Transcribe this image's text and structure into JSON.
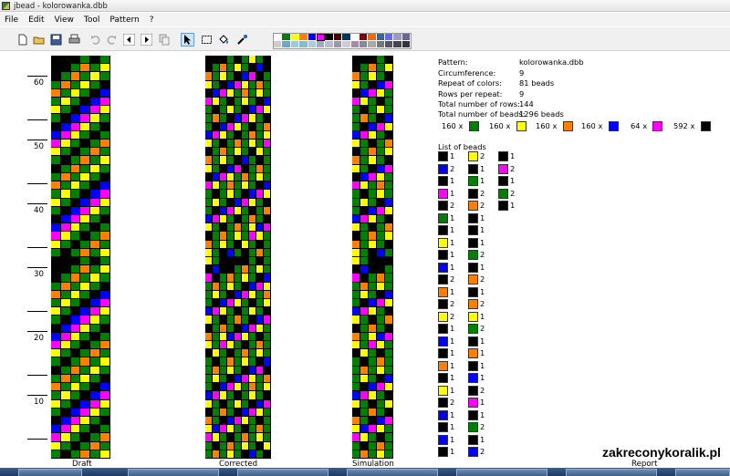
{
  "window": {
    "title": "jbead - kolorowanka.dbb"
  },
  "menu": [
    "File",
    "Edit",
    "View",
    "Tool",
    "Pattern",
    "?"
  ],
  "toolbar": {
    "icons": [
      "new-file-icon",
      "open-folder-icon",
      "save-disk-icon",
      "print-icon",
      "undo-icon",
      "redo-icon",
      "arrow-left-icon",
      "arrow-right-icon",
      "copy-icon",
      "pointer-icon",
      "select-rect-icon",
      "fill-bucket-icon",
      "eyedropper-icon"
    ]
  },
  "palette": [
    "#ffffff",
    "#008000",
    "#ffff00",
    "#ff8000",
    "#0000ff",
    "#ff00ff",
    "#000000",
    "#4d0000",
    "#003366",
    "#ffffff",
    "#800000",
    "#ff6600",
    "#336699",
    "#6666ff",
    "#9999cc",
    "#666699",
    "#cccccc",
    "#66aacc",
    "#99ccdd",
    "#88bbcc",
    "#aaccdd",
    "#99aacc",
    "#bbbbcc",
    "#9999aa",
    "#ccccdd",
    "#aa88aa",
    "#888899",
    "#aaaaaa",
    "#777777",
    "#555566",
    "#444455",
    "#333344"
  ],
  "colors": {
    "0": "#000000",
    "1": "#008000",
    "2": "#ffff00",
    "3": "#ff8000",
    "4": "#0000ff",
    "5": "#ff00ff"
  },
  "ruler": {
    "labels": [
      "60",
      "50",
      "40",
      "30",
      "20",
      "10"
    ]
  },
  "pattern_rows": [
    "000101210",
    "001312104",
    "013121045",
    "131210452",
    "312104521",
    "121045210",
    "210452101",
    "104521013",
    "045210131",
    "452101312",
    "521013121",
    "210131210",
    "101312104",
    "013121045",
    "131210452",
    "312104521",
    "121045210",
    "210452101",
    "104521013",
    "045210131",
    "452101312",
    "521013121",
    "210131210",
    "101312104"
  ],
  "report": {
    "rows": [
      {
        "label": "Pattern:",
        "value": "kolorowanka.dbb"
      },
      {
        "label": "Circumference:",
        "value": "9"
      },
      {
        "label": "Repeat of colors:",
        "value": "81 beads"
      },
      {
        "label": "Rows per repeat:",
        "value": "9"
      },
      {
        "label": "Total number of rows:",
        "value": "144"
      },
      {
        "label": "Total number of beads:",
        "value": "1296 beads"
      }
    ],
    "counts": [
      {
        "text": "160 x",
        "color": "#008000"
      },
      {
        "text": "160 x",
        "color": "#ffff00"
      },
      {
        "text": "160 x",
        "color": "#ff8000"
      },
      {
        "text": "160 x",
        "color": "#0000ff"
      },
      {
        "text": "64 x",
        "color": "#ff00ff"
      },
      {
        "text": "592 x",
        "color": "#000000"
      }
    ],
    "list_title": "List of beads",
    "bead_list": [
      [
        [
          "#000000",
          "1"
        ],
        [
          "#0000ff",
          "2"
        ],
        [
          "#000000",
          "1"
        ],
        [
          "#ff00ff",
          "1"
        ],
        [
          "#000000",
          "2"
        ],
        [
          "#008000",
          "1"
        ],
        [
          "#000000",
          "1"
        ],
        [
          "#ffff00",
          "1"
        ],
        [
          "#000000",
          "1"
        ],
        [
          "#0000ff",
          "1"
        ],
        [
          "#000000",
          "2"
        ],
        [
          "#ff8000",
          "1"
        ],
        [
          "#000000",
          "2"
        ],
        [
          "#ffff00",
          "2"
        ],
        [
          "#000000",
          "1"
        ],
        [
          "#0000ff",
          "1"
        ],
        [
          "#000000",
          "1"
        ],
        [
          "#ff8000",
          "1"
        ],
        [
          "#000000",
          "1"
        ],
        [
          "#ffff00",
          "1"
        ],
        [
          "#000000",
          "2"
        ],
        [
          "#0000ff",
          "1"
        ],
        [
          "#000000",
          "1"
        ],
        [
          "#0000ff",
          "1"
        ],
        [
          "#000000",
          "1"
        ]
      ],
      [
        [
          "#ffff00",
          "2"
        ],
        [
          "#000000",
          "1"
        ],
        [
          "#008000",
          "1"
        ],
        [
          "#000000",
          "2"
        ],
        [
          "#ff8000",
          "2"
        ],
        [
          "#000000",
          "1"
        ],
        [
          "#000000",
          "1"
        ],
        [
          "#000000",
          "1"
        ],
        [
          "#008000",
          "2"
        ],
        [
          "#000000",
          "1"
        ],
        [
          "#ff8000",
          "2"
        ],
        [
          "#000000",
          "1"
        ],
        [
          "#ff8000",
          "2"
        ],
        [
          "#ffff00",
          "1"
        ],
        [
          "#008000",
          "2"
        ],
        [
          "#000000",
          "1"
        ],
        [
          "#ff8000",
          "1"
        ],
        [
          "#000000",
          "1"
        ],
        [
          "#0000ff",
          "1"
        ],
        [
          "#000000",
          "2"
        ],
        [
          "#ff00ff",
          "1"
        ],
        [
          "#000000",
          "1"
        ],
        [
          "#008000",
          "2"
        ],
        [
          "#000000",
          "1"
        ],
        [
          "#0000ff",
          "2"
        ]
      ],
      [
        [
          "#000000",
          "1"
        ],
        [
          "#ff00ff",
          "2"
        ],
        [
          "#000000",
          "1"
        ],
        [
          "#008000",
          "2"
        ],
        [
          "#000000",
          "1"
        ]
      ]
    ]
  },
  "footer": {
    "draft": "Draft",
    "corrected": "Corrected",
    "simulation": "Simulation",
    "report": "Report"
  },
  "watermark": "zakreconykoralik.pl"
}
